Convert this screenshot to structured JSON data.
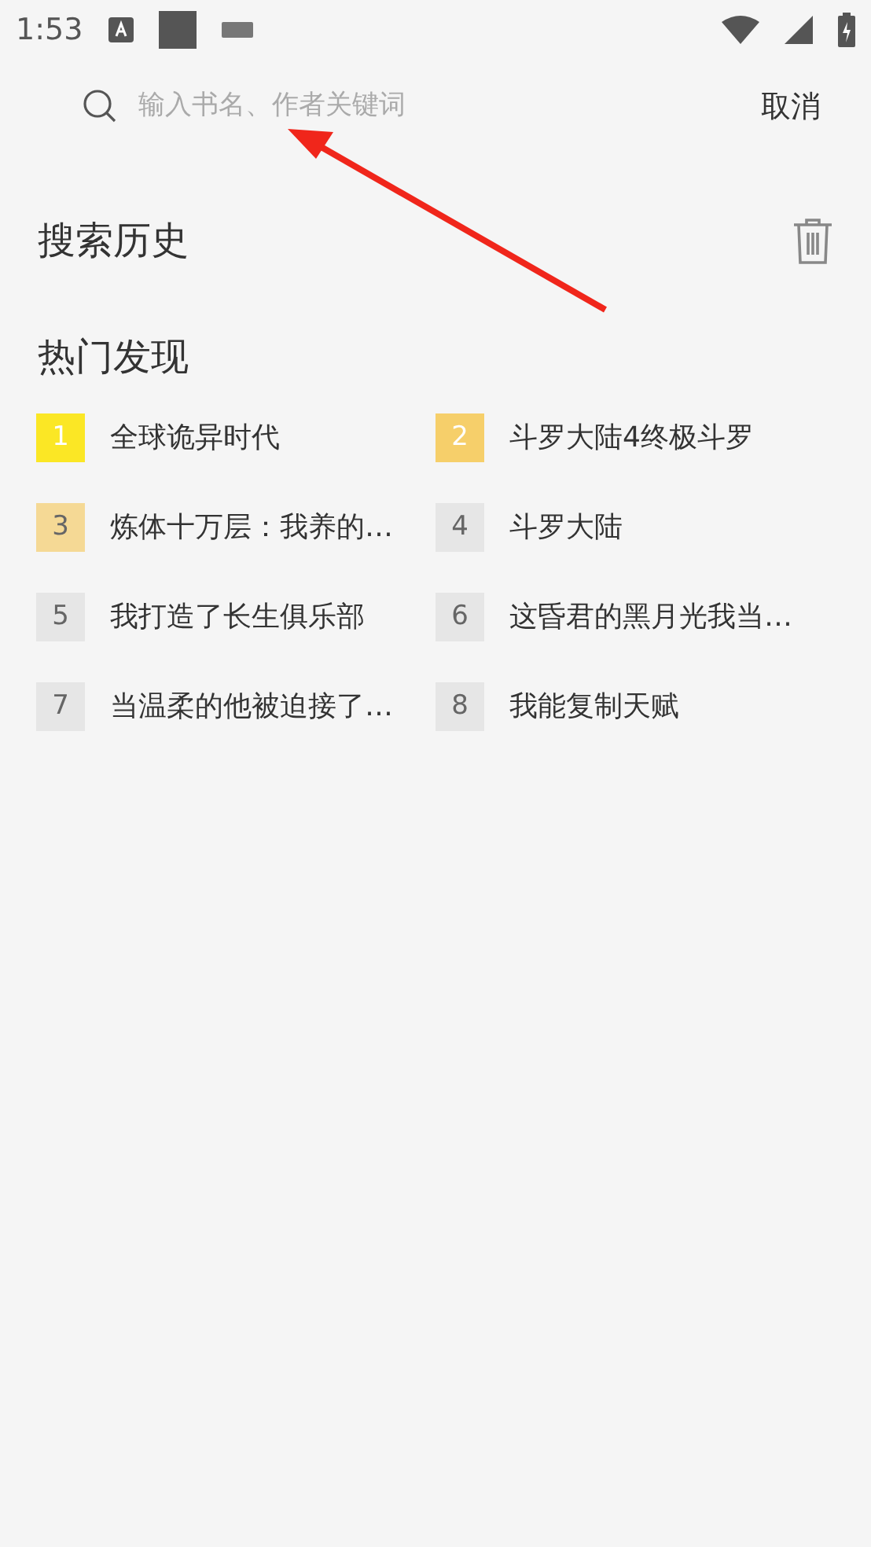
{
  "status_bar": {
    "time": "1:53"
  },
  "search": {
    "placeholder": "输入书名、作者关键词",
    "cancel": "取消"
  },
  "history": {
    "title": "搜索历史"
  },
  "hot": {
    "title": "热门发现",
    "items": [
      {
        "rank": "1",
        "title": "全球诡异时代",
        "color": "#fbe725"
      },
      {
        "rank": "2",
        "title": "斗罗大陆4终极斗罗",
        "color": "#f6cf6a"
      },
      {
        "rank": "3",
        "title": "炼体十万层：我养的…",
        "color": "#f5d995"
      },
      {
        "rank": "4",
        "title": "斗罗大陆",
        "color": "#e6e6e6"
      },
      {
        "rank": "5",
        "title": "我打造了长生俱乐部",
        "color": "#e6e6e6"
      },
      {
        "rank": "6",
        "title": "这昏君的黑月光我当…",
        "color": "#e6e6e6"
      },
      {
        "rank": "7",
        "title": "当温柔的他被迫接了…",
        "color": "#e6e6e6"
      },
      {
        "rank": "8",
        "title": "我能复制天赋",
        "color": "#e6e6e6"
      }
    ]
  }
}
